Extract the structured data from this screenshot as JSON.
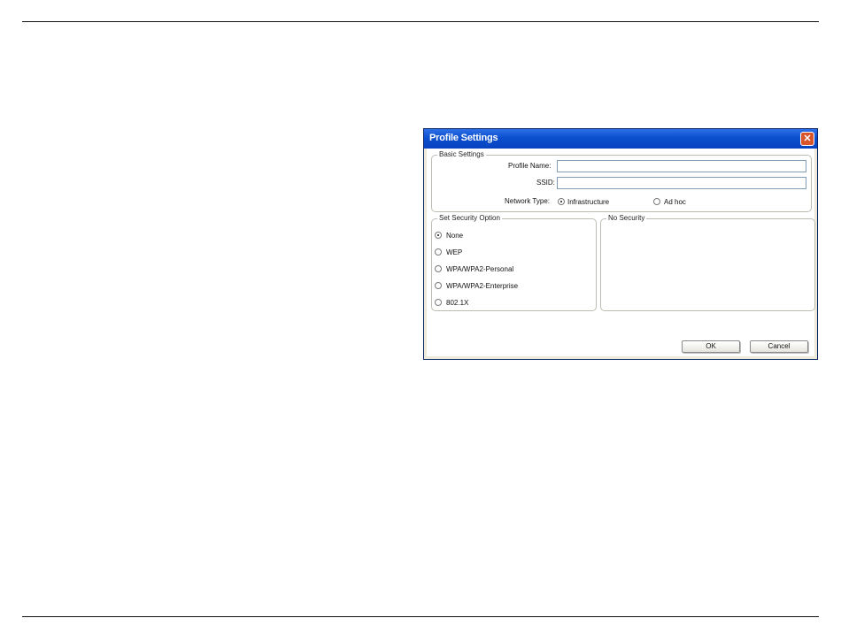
{
  "dialog": {
    "title": "Profile Settings",
    "close_glyph": "✕",
    "basic_settings": {
      "legend": "Basic Settings",
      "profile_name_label": "Profile Name:",
      "profile_name_value": "",
      "ssid_label": "SSID:",
      "ssid_value": "",
      "network_type_label": "Network Type:",
      "network_type_options": [
        "Infrastructure",
        "Ad hoc"
      ],
      "network_type_selected": "Infrastructure"
    },
    "security_option": {
      "legend": "Set Security Option",
      "options": [
        "None",
        "WEP",
        "WPA/WPA2-Personal",
        "WPA/WPA2-Enterprise",
        "802.1X"
      ],
      "selected": "None"
    },
    "security_detail": {
      "legend": "No Security"
    },
    "buttons": {
      "ok": "OK",
      "cancel": "Cancel"
    }
  }
}
